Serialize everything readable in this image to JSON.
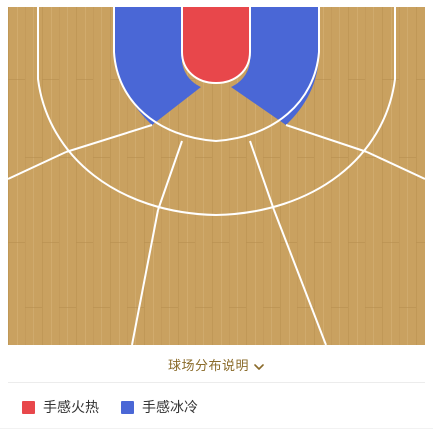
{
  "court": {
    "floor_color": "#c9a160",
    "line_color": "#ffffff",
    "zones": [
      {
        "name": "restricted-area",
        "status": "hot"
      },
      {
        "name": "paint-left",
        "status": "cold"
      },
      {
        "name": "paint-right",
        "status": "cold"
      },
      {
        "name": "mid-left-corner",
        "status": "neutral"
      },
      {
        "name": "mid-left-wing",
        "status": "neutral"
      },
      {
        "name": "mid-top",
        "status": "neutral"
      },
      {
        "name": "mid-right-wing",
        "status": "neutral"
      },
      {
        "name": "mid-right-corner",
        "status": "neutral"
      },
      {
        "name": "three-left-corner",
        "status": "neutral"
      },
      {
        "name": "three-left-wing",
        "status": "neutral"
      },
      {
        "name": "three-top",
        "status": "neutral"
      },
      {
        "name": "three-right-wing",
        "status": "neutral"
      },
      {
        "name": "three-right-corner",
        "status": "neutral"
      }
    ]
  },
  "expand": {
    "label": "球场分布说明",
    "icon": "chevron-down-icon"
  },
  "legend": {
    "items": [
      {
        "label": "手感火热",
        "color": "#e8474b"
      },
      {
        "label": "手感冰冷",
        "color": "#4a67d6"
      }
    ]
  }
}
